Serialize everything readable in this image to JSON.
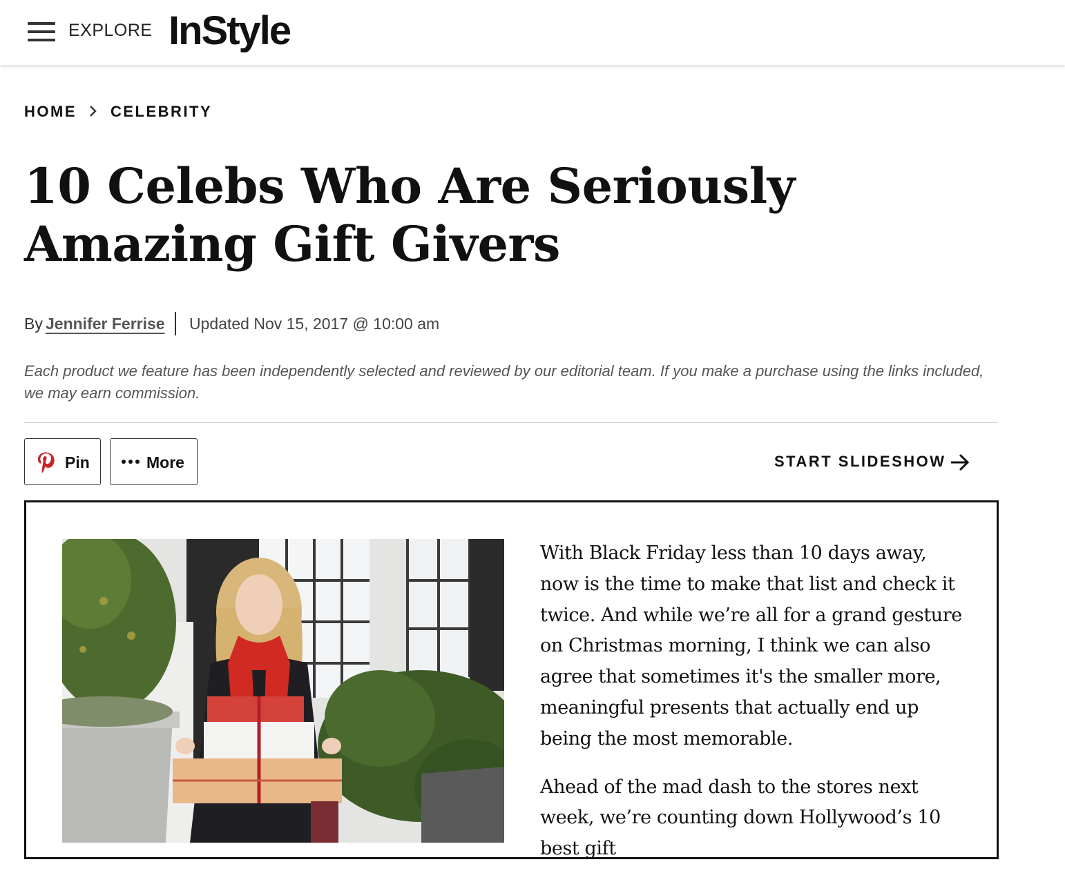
{
  "header": {
    "explore_label": "EXPLORE",
    "logo_text": "InStyle"
  },
  "breadcrumb": {
    "items": [
      "HOME",
      "CELEBRITY"
    ]
  },
  "article": {
    "title": "10 Celebs Who Are Seriously Amazing Gift Givers",
    "byline_prefix": "By",
    "author": "Jennifer Ferrise",
    "updated": "Updated Nov 15, 2017 @ 10:00 am",
    "disclaimer": "Each product we feature has been independently selected and reviewed by our editorial team. If you make a purchase using the links included, we may earn commission.",
    "paragraphs": [
      "With Black Friday less than 10 days away, now is the time to make that list and check it twice. And while we’re all for a grand gesture on Christmas morning, I think we can also agree that sometimes it's the smaller more, meaningful presents that actually end up being the most memorable.",
      "Ahead of the mad dash to the stores next week, we’re counting down Hollywood’s 10 best gift"
    ]
  },
  "actions": {
    "pin_label": "Pin",
    "more_label": "More",
    "slideshow_label": "START SLIDESHOW"
  },
  "icons": [
    "hamburger-menu-icon",
    "chevron-right-icon",
    "pinterest-icon",
    "more-dots-icon",
    "arrow-right-icon"
  ],
  "colors": {
    "pinterest_red": "#c8232c",
    "text": "#111111",
    "muted": "#555555",
    "card_border": "#111111"
  }
}
